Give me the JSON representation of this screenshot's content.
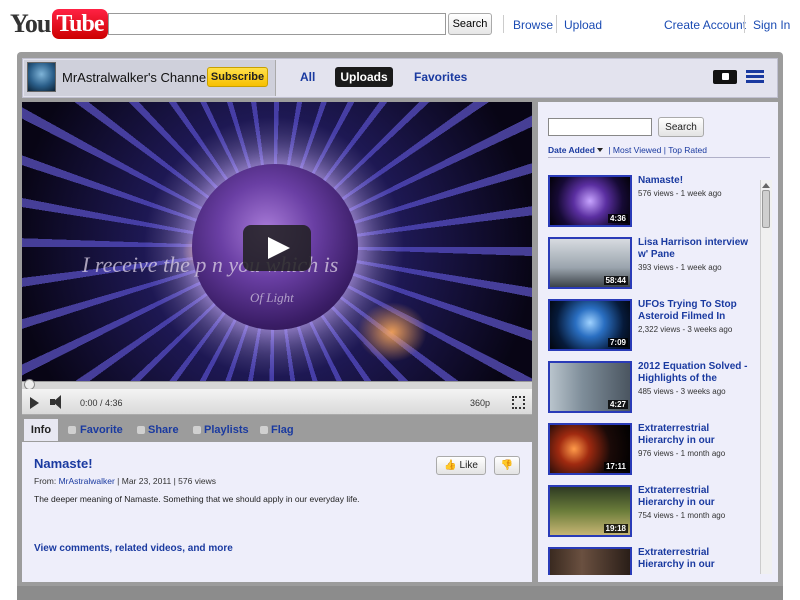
{
  "header": {
    "logo_you": "You",
    "logo_tube": "Tube",
    "search_button": "Search",
    "links": [
      "Browse",
      "Upload",
      "Create Account",
      "Sign In"
    ]
  },
  "channel": {
    "name": "MrAstralwalker's Channel",
    "subscribe": "Subscribe",
    "tabs": [
      "All",
      "Uploads",
      "Favorites"
    ],
    "active_tab": "Uploads"
  },
  "player": {
    "overlay_text": "I receive the p       n you which is",
    "overlay_sub": "Of Light",
    "time": "0:00 / 4:36",
    "quality": "360p",
    "progress": 0
  },
  "video_tabs": [
    "Info",
    "Favorite",
    "Share",
    "Playlists",
    "Flag"
  ],
  "info": {
    "title": "Namaste!",
    "from_label": "From:",
    "author": "MrAstralwalker",
    "date": "Mar 23, 2011",
    "views": "576 views",
    "description": "The deeper meaning of Namaste. Something that we should apply in our everyday life.",
    "more": "View comments, related videos, and more",
    "like": "Like"
  },
  "sidebar": {
    "search_button": "Search",
    "sort_active": "Date Added",
    "sort_links": [
      "Most Viewed",
      "Top Rated"
    ],
    "videos": [
      {
        "title": "Namaste!",
        "duration": "4:36",
        "meta": "576 views - 1 week ago"
      },
      {
        "title": "Lisa Harrison interview w' Pane",
        "duration": "58:44",
        "meta": "393 views - 1 week ago"
      },
      {
        "title": "UFOs Trying To Stop Asteroid Filmed In",
        "duration": "7:09",
        "meta": "2,322 views - 3 weeks ago"
      },
      {
        "title": "2012 Equation Solved - Highlights of the",
        "duration": "4:27",
        "meta": "485 views - 3 weeks ago"
      },
      {
        "title": "Extraterrestrial Hierarchy in our",
        "duration": "17:11",
        "meta": "976 views - 1 month ago"
      },
      {
        "title": "Extraterrestrial Hierarchy in our",
        "duration": "19:18",
        "meta": "754 views - 1 month ago"
      },
      {
        "title": "Extraterrestrial Hierarchy in our",
        "duration": "",
        "meta": ""
      }
    ]
  },
  "colors": {
    "link_blue": "#1a3aa0",
    "subscribe_yellow": "#f7c000",
    "frame_gray": "#9c9c9c",
    "panel_bg": "#eeeefa"
  }
}
